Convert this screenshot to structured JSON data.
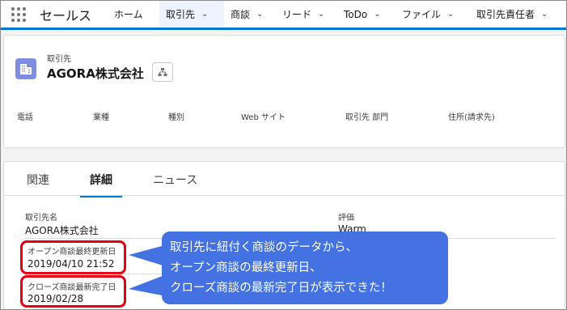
{
  "app": {
    "name": "セールス"
  },
  "nav": {
    "items": [
      {
        "label": "ホーム",
        "dropdown": false,
        "active": false
      },
      {
        "label": "取引先",
        "dropdown": true,
        "active": true
      },
      {
        "label": "商談",
        "dropdown": true,
        "active": false
      },
      {
        "label": "リード",
        "dropdown": true,
        "active": false
      },
      {
        "label": "ToDo",
        "dropdown": true,
        "active": false
      },
      {
        "label": "ファイル",
        "dropdown": true,
        "active": false
      },
      {
        "label": "取引先責任者",
        "dropdown": true,
        "active": false
      }
    ]
  },
  "record": {
    "type": "取引先",
    "name": "AGORA株式会社",
    "highlights": [
      "電話",
      "業種",
      "種別",
      "Web サイト",
      "取引先 部門",
      "住所(請求先)"
    ]
  },
  "tabs": [
    {
      "label": "関連"
    },
    {
      "label": "詳細"
    },
    {
      "label": "ニュース"
    }
  ],
  "fields": {
    "account_name": {
      "label": "取引先名",
      "value": "AGORA株式会社"
    },
    "rating": {
      "label": "評価",
      "value": "Warm"
    },
    "open_last_modified": {
      "label": "オープン商談最終更新日",
      "value": "2019/04/10 21:52"
    },
    "closed_last_completed": {
      "label": "クローズ商談最新完了日",
      "value": "2019/02/28"
    }
  },
  "callout": {
    "lines": [
      "取引先に紐付く商談のデータから、",
      "オープン商談の最終更新日、",
      "クローズ商談の最新完了日が表示できた！"
    ]
  },
  "colors": {
    "accent": "#0176d3",
    "highlight": "#e60012",
    "callout": "#4472e3",
    "record_icon": "#7f8de1"
  }
}
